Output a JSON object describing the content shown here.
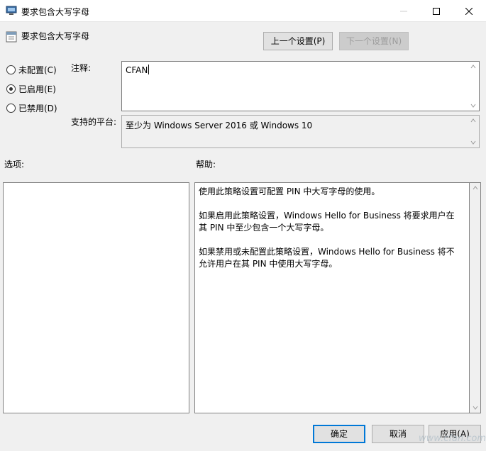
{
  "window": {
    "title": "要求包含大写字母",
    "minimize_icon": "minimize-icon",
    "maximize_icon": "maximize-icon",
    "close_icon": "close-icon"
  },
  "header": {
    "policy_name": "要求包含大写字母",
    "prev_label": "上一个设置(P)",
    "next_label": "下一个设置(N)"
  },
  "state": {
    "options": [
      {
        "label": "未配置(C)",
        "checked": false
      },
      {
        "label": "已启用(E)",
        "checked": true
      },
      {
        "label": "已禁用(D)",
        "checked": false
      }
    ]
  },
  "comment": {
    "label": "注释:",
    "value": "CFAN"
  },
  "platform": {
    "label": "支持的平台:",
    "value": "至少为 Windows Server 2016 或 Windows 10"
  },
  "sections": {
    "options_label": "选项:",
    "help_label": "帮助:"
  },
  "help": {
    "paragraphs": [
      "使用此策略设置可配置 PIN 中大写字母的使用。",
      "如果启用此策略设置，Windows Hello for Business 将要求用户在其 PIN 中至少包含一个大写字母。",
      "如果禁用或未配置此策略设置，Windows Hello for Business 将不允许用户在其 PIN 中使用大写字母。"
    ]
  },
  "footer": {
    "ok_label": "确定",
    "cancel_label": "取消",
    "apply_label": "应用(A)"
  },
  "watermark": "www.cfan.com.cn",
  "colors": {
    "accent": "#0078d7",
    "background": "#f0f0f0"
  }
}
